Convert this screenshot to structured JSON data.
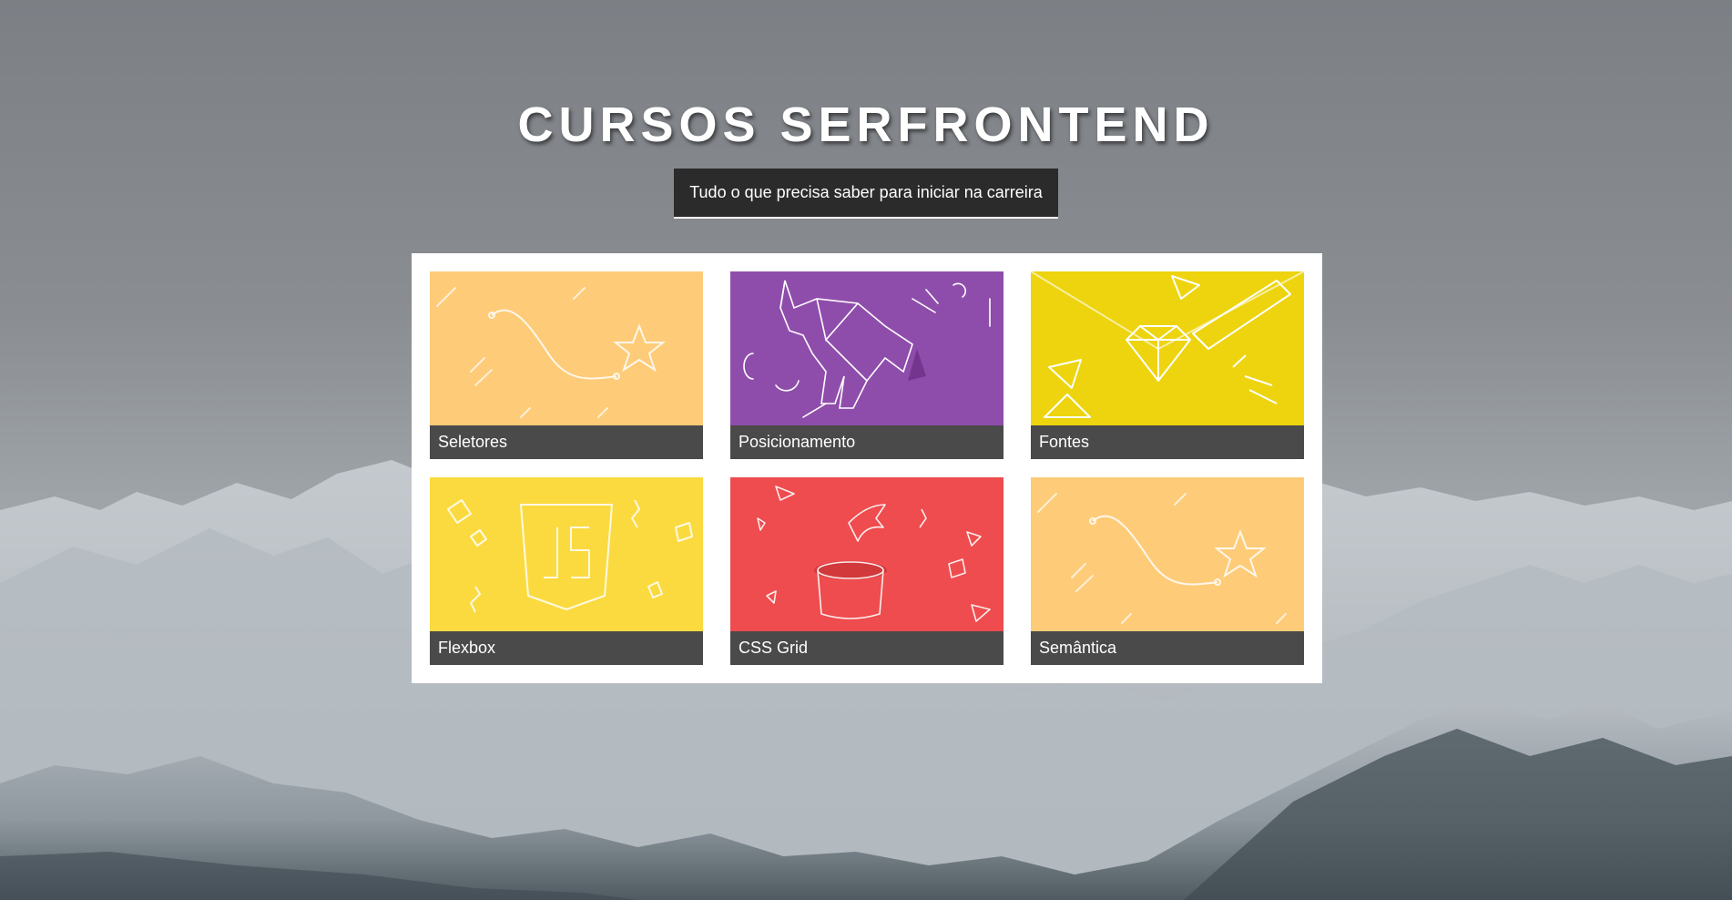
{
  "header": {
    "title": "CURSOS SERFRONTEND",
    "subtitle": "Tudo o que precisa saber para iniciar na carreira"
  },
  "courses": [
    {
      "label": "Seletores",
      "color": "#fecb78",
      "icon": "star-path-illustration"
    },
    {
      "label": "Posicionamento",
      "color": "#8f4dab",
      "icon": "origami-elephant-illustration"
    },
    {
      "label": "Fontes",
      "color": "#edd40f",
      "icon": "diamond-pencil-illustration"
    },
    {
      "label": "Flexbox",
      "color": "#fbda3f",
      "icon": "js-shield-illustration"
    },
    {
      "label": "CSS Grid",
      "color": "#ee4c4e",
      "icon": "magic-hat-illustration"
    },
    {
      "label": "Semântica",
      "color": "#fecb78",
      "icon": "star-path-illustration"
    }
  ],
  "colors": {
    "caption_bg": "#4a4a4a",
    "subtitle_bg": "#2b2b2b",
    "panel_bg": "#ffffff"
  }
}
